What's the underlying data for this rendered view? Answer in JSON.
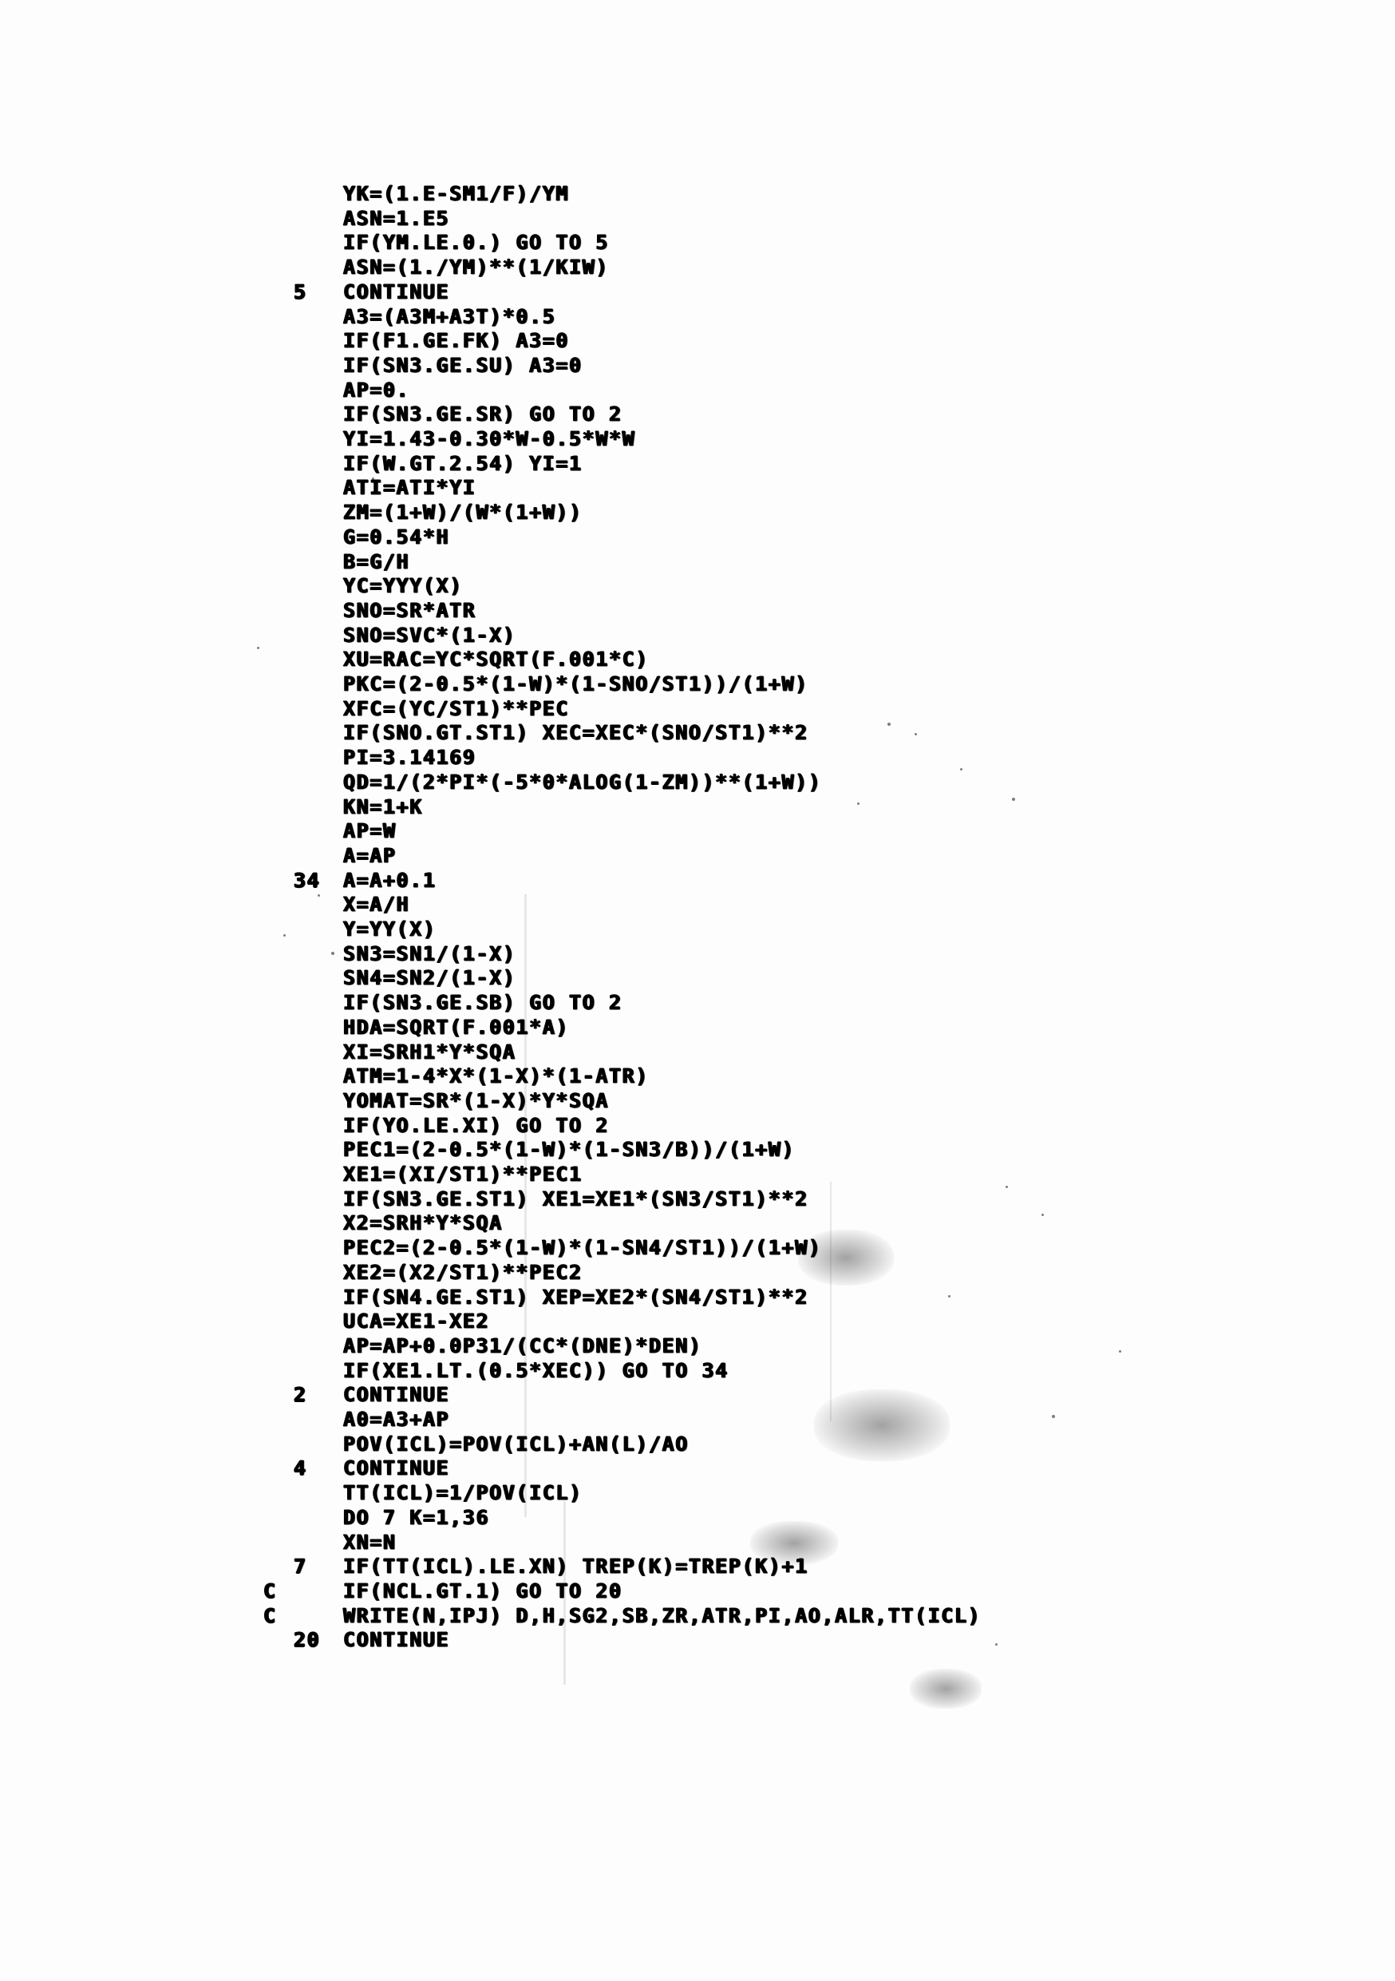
{
  "document": {
    "kind": "scanned-fortran-listing",
    "paper_color": "#ffffff",
    "ink_color": "#080808"
  },
  "listing": {
    "lines": [
      {
        "label": "",
        "text": "YK=(1.E-SM1/F)/YM"
      },
      {
        "label": "",
        "text": "ASN=1.E5"
      },
      {
        "label": "",
        "text": "IF(YM.LE.0.) GO TO 5"
      },
      {
        "label": "",
        "text": "ASN=(1./YM)**(1/KIW)"
      },
      {
        "label": "5",
        "text": "CONTINUE"
      },
      {
        "label": "",
        "text": "A3=(A3M+A3T)*0.5"
      },
      {
        "label": "",
        "text": "IF(F1.GE.FK) A3=0"
      },
      {
        "label": "",
        "text": "IF(SN3.GE.SU) A3=0"
      },
      {
        "label": "",
        "text": "AP=0."
      },
      {
        "label": "",
        "text": "IF(SN3.GE.SR) GO TO 2"
      },
      {
        "label": "",
        "text": "YI=1.43-0.30*W-0.5*W*W"
      },
      {
        "label": "",
        "text": "IF(W.GT.2.54) YI=1"
      },
      {
        "label": "",
        "text": "ATI=ATI*YI"
      },
      {
        "label": "",
        "text": "ZM=(1+W)/(W*(1+W))"
      },
      {
        "label": "",
        "text": "G=0.54*H"
      },
      {
        "label": "",
        "text": "B=G/H"
      },
      {
        "label": "",
        "text": "YC=YYY(X)"
      },
      {
        "label": "",
        "text": "SNO=SR*ATR"
      },
      {
        "label": "",
        "text": "SNO=SVC*(1-X)"
      },
      {
        "label": "",
        "text": "XU=RAC=YC*SQRT(F.001*C)"
      },
      {
        "label": "",
        "text": "PKC=(2-0.5*(1-W)*(1-SNO/ST1))/(1+W)"
      },
      {
        "label": "",
        "text": "XFC=(YC/ST1)**PEC"
      },
      {
        "label": "",
        "text": "IF(SNO.GT.ST1) XEC=XEC*(SNO/ST1)**2"
      },
      {
        "label": "",
        "text": "PI=3.14169"
      },
      {
        "label": "",
        "text": "QD=1/(2*PI*(-5*0*ALOG(1-ZM))**(1+W))"
      },
      {
        "label": "",
        "text": "KN=1+K"
      },
      {
        "label": "",
        "text": "AP=W"
      },
      {
        "label": "",
        "text": "A=AP"
      },
      {
        "label": "34",
        "text": "A=A+0.1"
      },
      {
        "label": "",
        "text": "X=A/H"
      },
      {
        "label": "",
        "text": "Y=YY(X)"
      },
      {
        "label": "",
        "text": "SN3=SN1/(1-X)"
      },
      {
        "label": "",
        "text": "SN4=SN2/(1-X)"
      },
      {
        "label": "",
        "text": "IF(SN3.GE.SB) GO TO 2"
      },
      {
        "label": "",
        "text": "HDA=SQRT(F.001*A)"
      },
      {
        "label": "",
        "text": "XI=SRH1*Y*SQA"
      },
      {
        "label": "",
        "text": "ATM=1-4*X*(1-X)*(1-ATR)"
      },
      {
        "label": "",
        "text": "YOMAT=SR*(1-X)*Y*SQA"
      },
      {
        "label": "",
        "text": "IF(YO.LE.XI) GO TO 2"
      },
      {
        "label": "",
        "text": "PEC1=(2-0.5*(1-W)*(1-SN3/B))/(1+W)"
      },
      {
        "label": "",
        "text": "XE1=(XI/ST1)**PEC1"
      },
      {
        "label": "",
        "text": "IF(SN3.GE.ST1) XE1=XE1*(SN3/ST1)**2"
      },
      {
        "label": "",
        "text": "X2=SRH*Y*SQA"
      },
      {
        "label": "",
        "text": "PEC2=(2-0.5*(1-W)*(1-SN4/ST1))/(1+W)"
      },
      {
        "label": "",
        "text": "XE2=(X2/ST1)**PEC2"
      },
      {
        "label": "",
        "text": "IF(SN4.GE.ST1) XEP=XE2*(SN4/ST1)**2"
      },
      {
        "label": "",
        "text": "UCA=XE1-XE2"
      },
      {
        "label": "",
        "text": "AP=AP+0.0P31/(CC*(DNE)*DEN)"
      },
      {
        "label": "",
        "text": "IF(XE1.LT.(0.5*XEC)) GO TO 34"
      },
      {
        "label": "2",
        "text": "CONTINUE"
      },
      {
        "label": "",
        "text": "A0=A3+AP"
      },
      {
        "label": "",
        "text": "POV(ICL)=POV(ICL)+AN(L)/AO"
      },
      {
        "label": "4",
        "text": "CONTINUE"
      },
      {
        "label": "",
        "text": "TT(ICL)=1/POV(ICL)"
      },
      {
        "label": "",
        "text": "DO 7 K=1,36"
      },
      {
        "label": "",
        "text": "XN=N"
      },
      {
        "label": "7",
        "text": "IF(TT(ICL).LE.XN) TREP(K)=TREP(K)+1"
      },
      {
        "label": "C",
        "text": "IF(NCL.GT.1) GO TO 20"
      },
      {
        "label": "C",
        "text": "WRITE(N,IPJ) D,H,SG2,SB,ZR,ATR,PI,AO,ALR,TT(ICL)"
      },
      {
        "label": "20",
        "text": "CONTINUE"
      }
    ]
  }
}
